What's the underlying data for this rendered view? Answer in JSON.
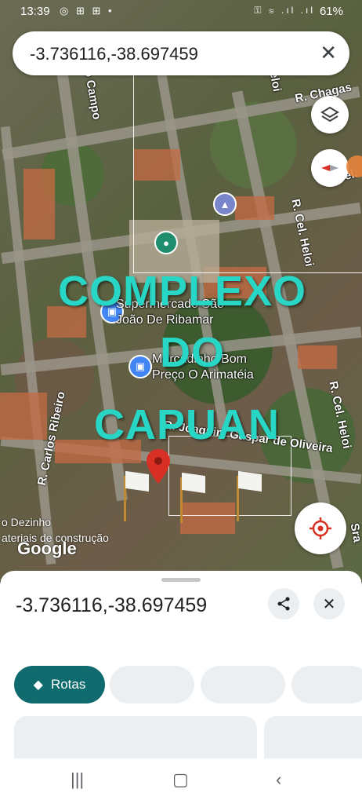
{
  "status": {
    "time": "13:39",
    "left_icons": "◎ ⊞ ⊞ •",
    "right_icons": "⚿ ≋ .ıl .ıl",
    "battery": "61%"
  },
  "search": {
    "query": "-3.736116,-38.697459",
    "close_label": "✕"
  },
  "map": {
    "streets": {
      "campo": "o Campo",
      "chagas": "R. Chagas",
      "cel_heloi_1": "R. Cel. Heloi",
      "cel_heloi_2": "R. Cel.",
      "carlos_ribeiro": "R. Carlos Ribeiro",
      "gaspar": "R. Joaquim Gaspar de Oliveira",
      "dezinho": "o Dezinho",
      "materiais": "ateriais de construção",
      "sra": "Sra",
      "heloi_top": "Heloi"
    },
    "pois": {
      "supermercado": "Supermercado São\nJoão De Ribamar",
      "mercadinho": "Mercadinho Bom\nPreço O Arimatéia"
    },
    "overlay_text": [
      "COMPLEXO",
      "DO",
      "CAPUAN"
    ],
    "google_logo": "Google",
    "icons": {
      "layers": "layers-icon",
      "compass": "compass-icon",
      "locate": "my-location-icon"
    }
  },
  "sheet": {
    "coordinates": "-3.736116,-38.697459",
    "share_icon": "share-icon",
    "close_icon": "close-icon",
    "directions_label": "Rotas"
  },
  "colors": {
    "overlay": "#28d6c5",
    "primary_chip": "#0f6b6e",
    "pin_red": "#d93025"
  }
}
